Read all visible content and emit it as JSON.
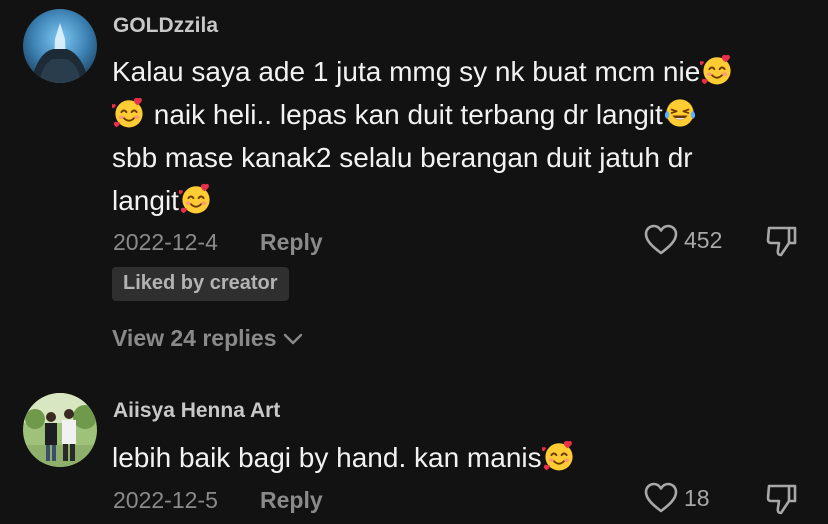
{
  "comments": [
    {
      "username": "GOLDzzila",
      "lines": [
        {
          "text": "Kalau saya ade 1 juta mmg sy nk buat mcm nie",
          "emoji_after": "smiling-face-with-hearts"
        },
        {
          "emoji_before": "smiling-face-with-hearts",
          "text": " naik heli.. lepas kan duit terbang dr langit",
          "emoji_after": "face-with-tears-of-joy"
        },
        {
          "text": "sbb mase kanak2 selalu berangan duit jatuh dr"
        },
        {
          "text": "langit",
          "emoji_after": "smiling-face-with-hearts"
        }
      ],
      "date": "2022-12-4",
      "reply_label": "Reply",
      "like_count": "452",
      "badge": "Liked by creator",
      "view_replies": "View 24 replies"
    },
    {
      "username": "Aiisya Henna Art",
      "lines": [
        {
          "text": "lebih baik bagi by hand. kan manis",
          "emoji_after": "smiling-face-with-hearts"
        }
      ],
      "date": "2022-12-5",
      "reply_label": "Reply",
      "like_count": "18"
    }
  ],
  "icons": {
    "like": "heart-outline-icon",
    "dislike": "thumbs-down-icon",
    "expand": "chevron-down-icon"
  },
  "colors": {
    "background": "#121212",
    "username": "#c8c8c8",
    "text": "#f2f2f2",
    "meta": "#8a8a8a",
    "badge_bg": "#2f2f2f"
  }
}
